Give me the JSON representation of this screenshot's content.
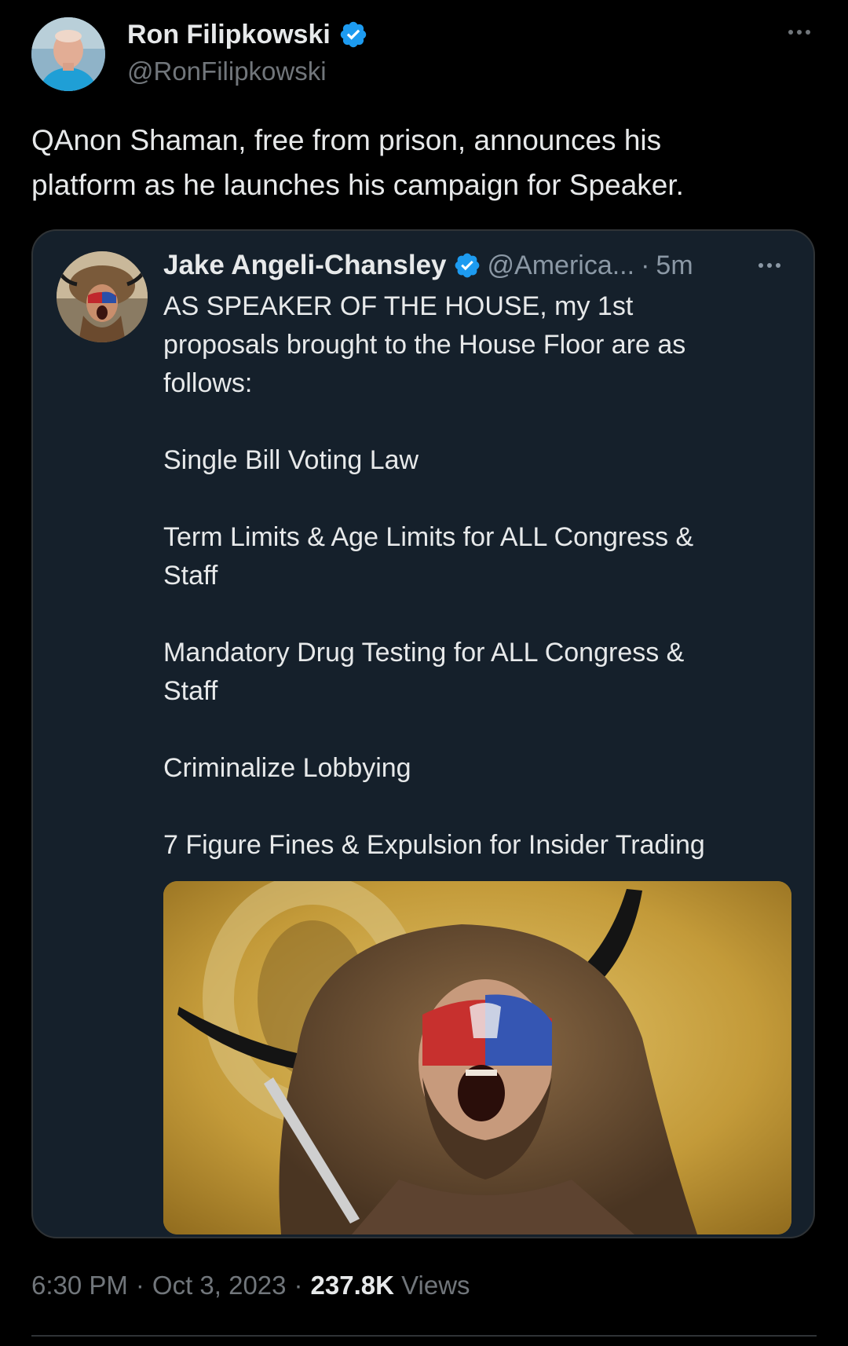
{
  "author": {
    "name": "Ron Filipkowski",
    "handle": "@RonFilipkowski",
    "verified": true,
    "avatar_icon": "profile-photo"
  },
  "tweet": {
    "text_lines": [
      "QAnon Shaman, free from prison, announces his",
      "platform as he launches his campaign for Speaker."
    ]
  },
  "quote": {
    "name": "Jake Angeli-Chansley",
    "handle": "@America...",
    "separator": "·",
    "time": "5m",
    "verified": true,
    "body_lines": [
      "AS SPEAKER OF THE HOUSE, my 1st",
      "proposals brought to the House Floor are as",
      "follows:",
      "",
      "Single Bill Voting Law",
      "",
      "Term Limits & Age Limits for ALL Congress &",
      "Staff",
      "",
      "Mandatory Drug Testing for ALL Congress &",
      "Staff",
      "",
      "Criminalize Lobbying",
      "",
      "7 Figure Fines & Expulsion for Insider Trading"
    ],
    "media_icon": "photo-man-horned-fur-hat-face-paint"
  },
  "meta": {
    "time": "6:30 PM",
    "sep1": "·",
    "date": "Oct 3, 2023",
    "sep2": "·",
    "views_count": "237.8K",
    "views_label": "Views"
  },
  "colors": {
    "background": "#000000",
    "card_background": "#15202b",
    "text_primary": "#e7e9ea",
    "text_secondary": "#71767b",
    "verified_blue": "#1d9bf0",
    "border": "#2f3336"
  }
}
